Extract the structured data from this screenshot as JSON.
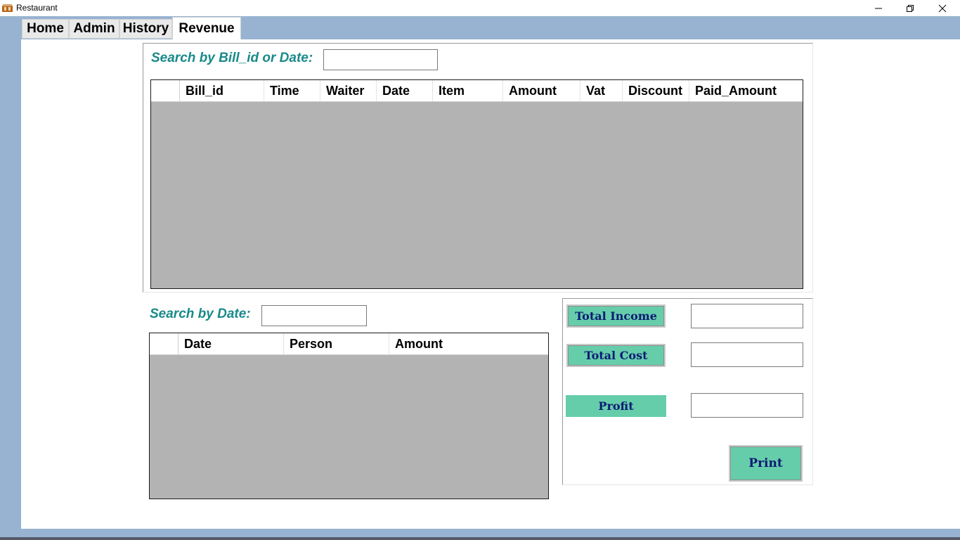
{
  "window": {
    "title": "Restaurant",
    "app_icon": "restaurant-app-icon",
    "controls": [
      "minimize-icon",
      "restore-icon",
      "close-icon"
    ]
  },
  "tabs": [
    {
      "label": "Home",
      "active": false
    },
    {
      "label": "Admin",
      "active": false
    },
    {
      "label": "History",
      "active": false
    },
    {
      "label": "Revenue",
      "active": true
    }
  ],
  "bill_search": {
    "label": "Search by Bill_id or Date:",
    "value": ""
  },
  "bills_table": {
    "columns": [
      "Bill_id",
      "Time",
      "Waiter",
      "Date",
      "Item",
      "Amount",
      "Vat",
      "Discount",
      "Paid_Amount"
    ],
    "rows": []
  },
  "date_search": {
    "label": "Search by Date:",
    "value": ""
  },
  "costs_table": {
    "columns": [
      "Date",
      "Person",
      "Amount"
    ],
    "rows": []
  },
  "summary": {
    "total_income_label": "Total Income",
    "total_income_value": "",
    "total_cost_label": "Total Cost",
    "total_cost_value": "",
    "profit_label": "Profit",
    "profit_value": "",
    "print_label": "Print"
  },
  "colors": {
    "tab_strip": "#98b3d1",
    "search_label": "#1a8a8a",
    "button_bg": "#66cdaa",
    "button_text": "#0b1a75",
    "grid_bg": "#b3b3b3"
  }
}
